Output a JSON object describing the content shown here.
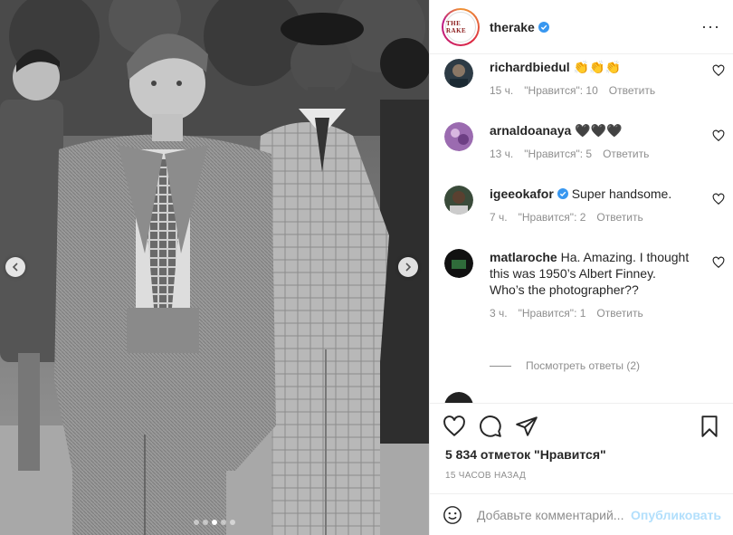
{
  "header": {
    "username": "therake",
    "avatar_text": "THE RAKE",
    "more_icon": "more-horizontal-icon"
  },
  "comments": [
    {
      "user": "richardbiedul",
      "text": "👏👏👏",
      "time": "15 ч.",
      "likes": "\"Нравится\": 10",
      "reply": "Ответить",
      "verified": false
    },
    {
      "user": "arnaldoanaya",
      "text": "🖤🖤🖤",
      "time": "13 ч.",
      "likes": "\"Нравится\": 5",
      "reply": "Ответить",
      "verified": false
    },
    {
      "user": "igeeokafor",
      "text": "Super handsome.",
      "time": "7 ч.",
      "likes": "\"Нравится\": 2",
      "reply": "Ответить",
      "verified": true
    },
    {
      "user": "matlaroche",
      "text": "Ha. Amazing. I thought this was 1950’s Albert Finney. Who’s the photographer??",
      "time": "3 ч.",
      "likes": "\"Нравится\": 1",
      "reply": "Ответить",
      "verified": false
    }
  ],
  "view_replies": "Посмотреть ответы (2)",
  "likes_count": "5 834 отметок \"Нравится\"",
  "timestamp": "15 ЧАСОВ НАЗАД",
  "add_comment": {
    "placeholder": "Добавьте комментарий...",
    "post_label": "Опубликовать"
  },
  "carousel": {
    "slides": 5,
    "active_index": 2
  },
  "colors": {
    "accent": "#0095f6",
    "post_disabled": "#b2dffc",
    "muted": "#8e8e8e",
    "verified": "#3897f0"
  }
}
